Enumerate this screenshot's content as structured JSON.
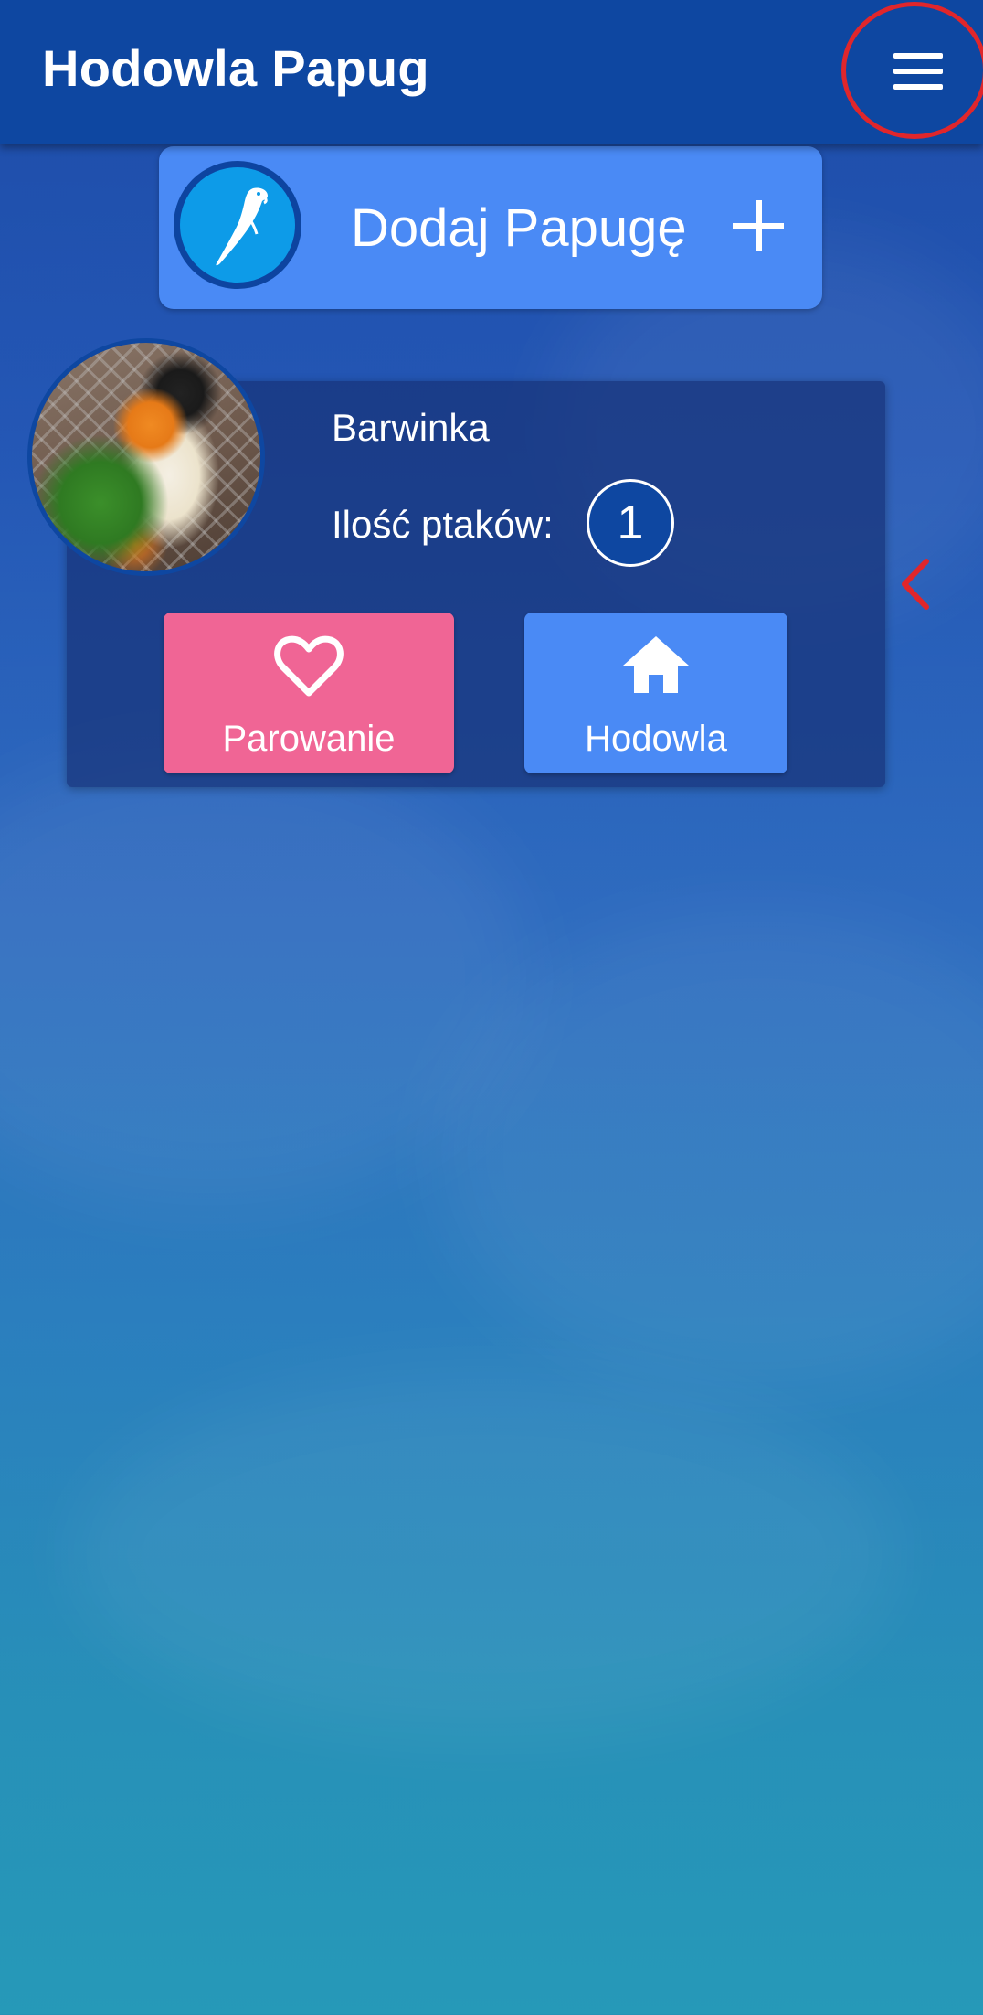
{
  "app_bar": {
    "title": "Hodowla Papug",
    "menu_icon": "hamburger-menu-icon"
  },
  "add_parrot": {
    "label": "Dodaj Papugę",
    "avatar_icon": "parrot-icon",
    "action_icon": "plus-icon"
  },
  "parrot": {
    "name": "Barwinka",
    "bird_count_label": "Ilość ptaków:",
    "bird_count": "1",
    "photo": "parrot-photo"
  },
  "actions": {
    "pairing_label": "Parowanie",
    "pairing_icon": "heart-icon",
    "breeding_label": "Hodowla",
    "breeding_icon": "home-icon"
  },
  "colors": {
    "app_bar": "#0e47a1",
    "add_card": "#4a8af5",
    "pairing_button": "#f06595",
    "breeding_button": "#4a8af5",
    "highlight_ring": "#e0262b",
    "chevron": "#e0262b"
  }
}
